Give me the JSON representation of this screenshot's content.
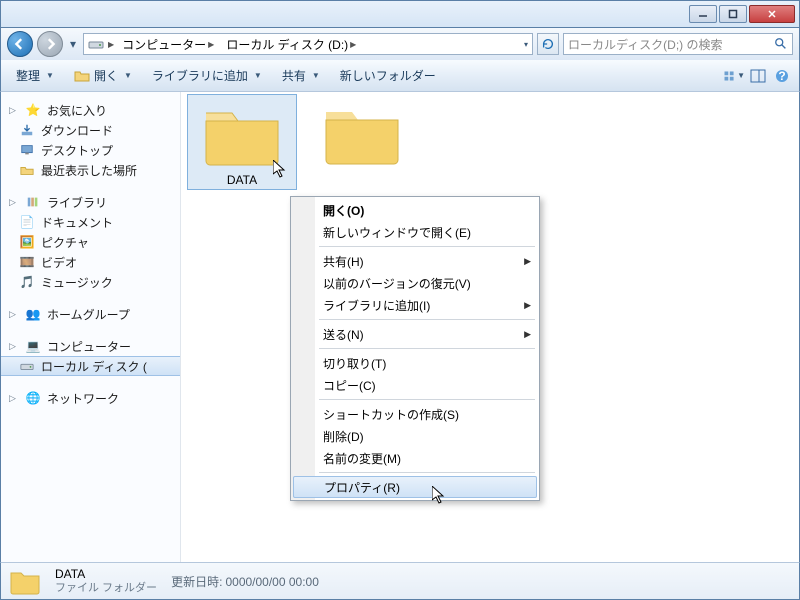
{
  "breadcrumb": {
    "root": "コンピューター",
    "drive": "ローカル ディスク (D:)"
  },
  "search": {
    "placeholder": "ローカルディスク(D;) の検索"
  },
  "toolbar": {
    "organize": "整理",
    "open": "開く",
    "add_to_library": "ライブラリに追加",
    "share": "共有",
    "new_folder": "新しいフォルダー"
  },
  "sidebar": {
    "favorites": {
      "label": "お気に入り",
      "items": [
        "ダウンロード",
        "デスクトップ",
        "最近表示した場所"
      ]
    },
    "libraries": {
      "label": "ライブラリ",
      "items": [
        "ドキュメント",
        "ピクチャ",
        "ビデオ",
        "ミュージック"
      ]
    },
    "homegroup": {
      "label": "ホームグループ"
    },
    "computer": {
      "label": "コンピューター",
      "items": [
        "ローカル ディスク ("
      ]
    },
    "network": {
      "label": "ネットワーク"
    }
  },
  "folders": [
    {
      "name": "DATA",
      "selected": true
    },
    {
      "name": "",
      "selected": false
    }
  ],
  "context_menu": {
    "items": [
      {
        "label": "開く(O)",
        "bold": true
      },
      {
        "label": "新しいウィンドウで開く(E)"
      },
      {
        "sep": true
      },
      {
        "label": "共有(H)",
        "submenu": true
      },
      {
        "label": "以前のバージョンの復元(V)"
      },
      {
        "label": "ライブラリに追加(I)",
        "submenu": true
      },
      {
        "sep": true
      },
      {
        "label": "送る(N)",
        "submenu": true
      },
      {
        "sep": true
      },
      {
        "label": "切り取り(T)"
      },
      {
        "label": "コピー(C)"
      },
      {
        "sep": true
      },
      {
        "label": "ショートカットの作成(S)"
      },
      {
        "label": "削除(D)"
      },
      {
        "label": "名前の変更(M)"
      },
      {
        "sep": true
      },
      {
        "label": "プロパティ(R)",
        "selected": true
      }
    ]
  },
  "details": {
    "name": "DATA",
    "type": "ファイル フォルダー",
    "modified_label": "更新日時:",
    "modified_value": "0000/00/00 00:00"
  }
}
